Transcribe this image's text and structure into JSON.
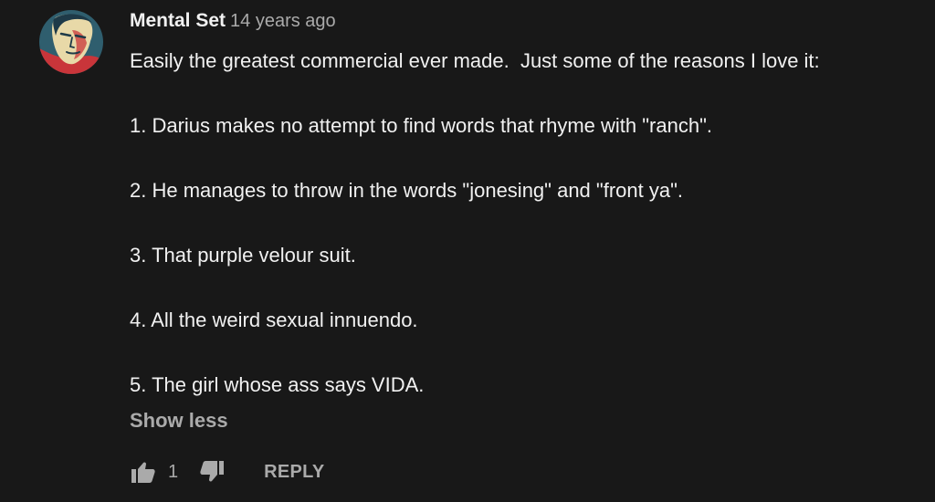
{
  "comment": {
    "author": "Mental Set",
    "timestamp": "14 years ago",
    "avatar_icon": "user-avatar-portrait",
    "lines": [
      "Easily the greatest commercial ever made.  Just some of the reasons I love it:",
      "1. Darius makes no attempt to find words that rhyme with \"ranch\".",
      "2. He manages to throw in the words \"jonesing\" and \"front ya\".",
      "3. That purple velour suit.",
      "4. All the weird sexual innuendo.",
      "5. The girl whose ass says VIDA."
    ],
    "show_less_label": "Show less",
    "like_count": "1",
    "like_icon": "thumbs-up-icon",
    "dislike_icon": "thumbs-down-icon",
    "reply_label": "REPLY"
  },
  "colors": {
    "background": "#181818",
    "primary_text": "#f1f1f1",
    "secondary_text": "#aaaaaa"
  }
}
